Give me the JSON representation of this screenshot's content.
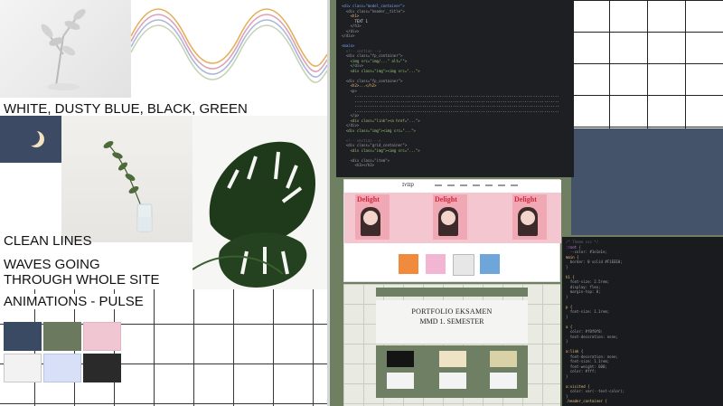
{
  "moodboard": {
    "palette_title": "WHITE, DUSTY BLUE, BLACK, GREEN",
    "notes": [
      "CLEAN LINES",
      "WAVES GOING\nTHROUGH WHOLE SITE",
      "ANIMATIONS - PULSE"
    ],
    "colors": [
      "#3b4a63",
      "#6b7a5e",
      "#f0c6d2",
      "#f2f2f2",
      "#d7e0f7",
      "#2a2a2a"
    ]
  },
  "screens": {
    "portfolio_title": "PORTFOLIO EKSAMEN",
    "portfolio_subtitle": "MMD 1. SEMESTER",
    "mag_word": "Delight",
    "logo": "ɪʏɪɪp"
  }
}
